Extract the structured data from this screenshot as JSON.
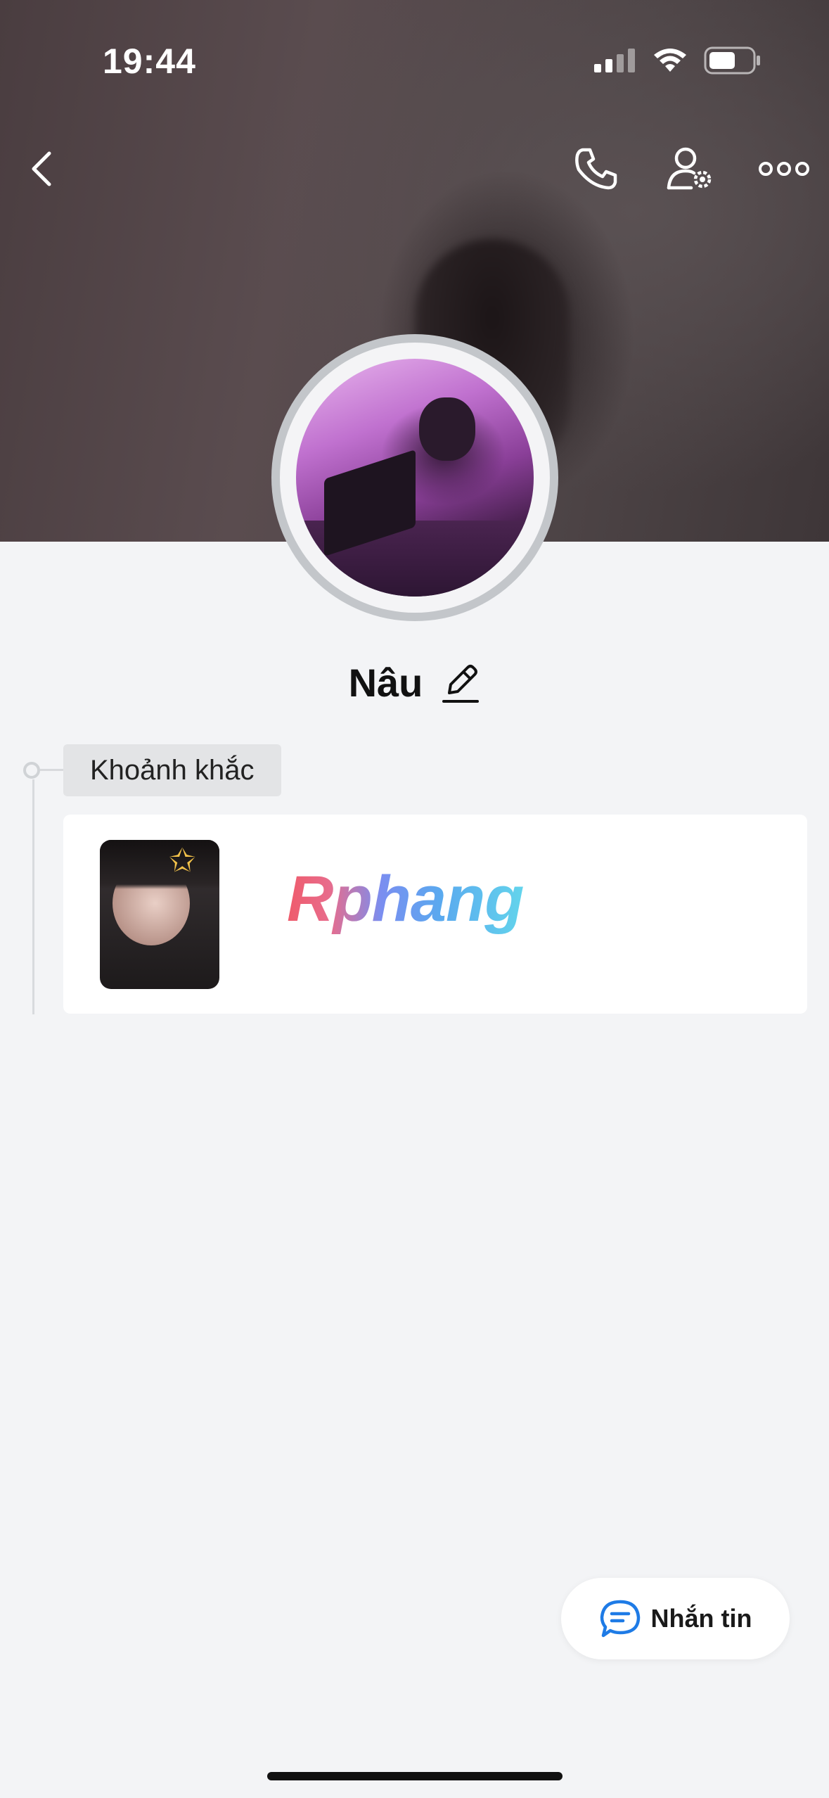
{
  "status_bar": {
    "time": "19:44",
    "icons": [
      "cellular-signal-icon",
      "wifi-icon",
      "battery-icon"
    ]
  },
  "header": {
    "buttons": [
      "back-icon",
      "phone-icon",
      "user-settings-icon",
      "more-icon"
    ]
  },
  "profile": {
    "name": "Nâu",
    "edit_icon": "pencil-icon"
  },
  "moments": {
    "label": "Khoảnh khắc",
    "watermark": "Rphang"
  },
  "actions": {
    "message_label": "Nhắn tin",
    "message_icon": "chat-bubble-icon"
  },
  "colors": {
    "accent": "#1e7be6",
    "background": "#f3f4f6"
  }
}
